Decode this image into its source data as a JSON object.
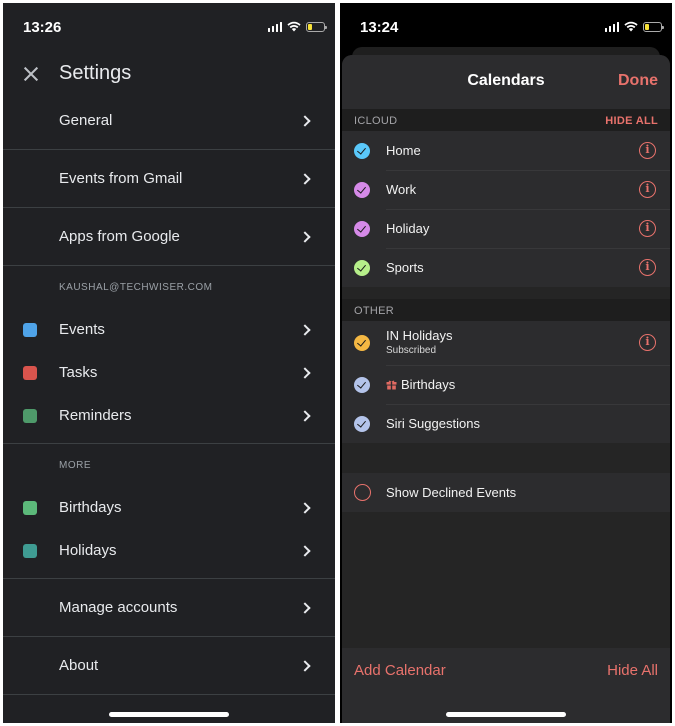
{
  "left": {
    "status_bar": {
      "time": "13:26"
    },
    "header": {
      "title": "Settings",
      "close_icon": "close-icon"
    },
    "top_items": [
      {
        "label": "General"
      },
      {
        "label": "Events from Gmail"
      },
      {
        "label": "Apps from Google"
      }
    ],
    "account_section": {
      "label": "KAUSHAL@TECHWISER.COM",
      "items": [
        {
          "label": "Events",
          "color": "#4fa3e8"
        },
        {
          "label": "Tasks",
          "color": "#d9544d"
        },
        {
          "label": "Reminders",
          "color": "#4e9a6a"
        }
      ]
    },
    "more_section": {
      "label": "MORE",
      "items": [
        {
          "label": "Birthdays",
          "color": "#5cb97a"
        },
        {
          "label": "Holidays",
          "color": "#3f9c93"
        }
      ]
    },
    "bottom_items": [
      {
        "label": "Manage accounts"
      },
      {
        "label": "About"
      }
    ]
  },
  "right": {
    "status_bar": {
      "time": "13:24"
    },
    "nav": {
      "title": "Calendars",
      "done_label": "Done"
    },
    "icloud": {
      "label": "ICLOUD",
      "action": "HIDE ALL",
      "calendars": [
        {
          "name": "Home",
          "color": "#5ac8fa",
          "checked": true
        },
        {
          "name": "Work",
          "color": "#d68ae8",
          "checked": true
        },
        {
          "name": "Holiday",
          "color": "#d68ae8",
          "checked": true
        },
        {
          "name": "Sports",
          "color": "#b6ef8a",
          "checked": true
        }
      ]
    },
    "other": {
      "label": "OTHER",
      "calendars": [
        {
          "name": "IN Holidays",
          "subtitle": "Subscribed",
          "color": "#f5b843",
          "checked": true
        },
        {
          "name": "Birthdays",
          "color": "#b4c4ea",
          "checked": true,
          "icon": "gift-icon"
        },
        {
          "name": "Siri Suggestions",
          "color": "#b4c4ea",
          "checked": true
        }
      ]
    },
    "declined": {
      "label": "Show Declined Events",
      "checked": false
    },
    "footer": {
      "add_label": "Add Calendar",
      "hide_label": "Hide All"
    },
    "accent": "#e8726c"
  }
}
